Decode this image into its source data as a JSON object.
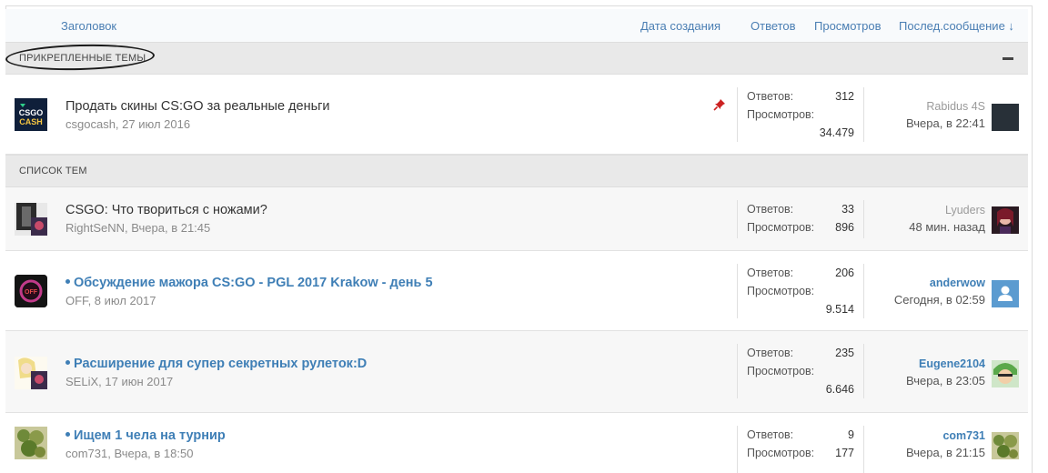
{
  "header": {
    "title": "Заголовок",
    "created": "Дата создания",
    "replies": "Ответов",
    "views": "Просмотров",
    "last_post": "Послед.сообщение ↓"
  },
  "sections": {
    "sticky": "ПРИКРЕПЛЕННЫЕ ТЕМЫ",
    "list": "СПИСОК ТЕМ"
  },
  "labels": {
    "replies": "Ответов:",
    "views": "Просмотров:"
  },
  "sticky_threads": [
    {
      "title": "Продать скины CS:GO за реальные деньги",
      "author": "csgocash",
      "date": "27 июл 2016",
      "replies": "312",
      "views": "34.479",
      "last_user": "Rabidus 4S",
      "last_time": "Вчера, в 22:41",
      "avatar_icon": "csgo-cash-logo",
      "avatar_text": "CSGO CASH",
      "pin_icon": "pin-icon"
    }
  ],
  "threads": [
    {
      "title": "CSGO: Что твориться с ножами?",
      "author": "RightSeNN",
      "date": "Вчера, в 21:45",
      "replies": "33",
      "views": "896",
      "last_user": "Lyuders",
      "last_time": "48 мин. назад"
    },
    {
      "title": "Обсуждение мажора CS:GO - PGL 2017 Krakow - день 5",
      "author": "OFF",
      "date": "8 июл 2017",
      "replies": "206",
      "views": "9.514",
      "last_user": "anderwow",
      "last_time": "Сегодня, в 02:59",
      "avatar_text": "OFF"
    },
    {
      "title": "Расширение для супер секретных рулеток:D",
      "author": "SELiX",
      "date": "17 июн 2017",
      "replies": "235",
      "views": "6.646",
      "last_user": "Eugene2104",
      "last_time": "Вчера, в 23:05"
    },
    {
      "title": "Ищем 1 чела на турнир",
      "author": "com731",
      "date": "Вчера, в 18:50",
      "replies": "9",
      "views": "177",
      "last_user": "com731",
      "last_time": "Вчера, в 21:15"
    }
  ],
  "colors": {
    "link": "#3f7fb6",
    "section_bg": "#e9e9e9",
    "row_bg": "#f7f7f7"
  }
}
